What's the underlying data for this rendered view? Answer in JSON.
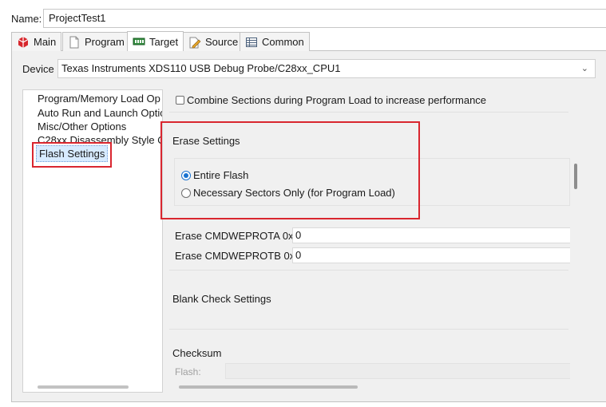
{
  "name": {
    "label": "Name:",
    "value": "ProjectTest1"
  },
  "tabs": [
    {
      "label": "Main",
      "icon": "main-tab-icon"
    },
    {
      "label": "Program",
      "icon": "program-tab-icon"
    },
    {
      "label": "Target",
      "icon": "target-tab-icon",
      "active": true
    },
    {
      "label": "Source",
      "icon": "source-tab-icon"
    },
    {
      "label": "Common",
      "icon": "common-tab-icon"
    }
  ],
  "device": {
    "label": "Device",
    "value": "Texas Instruments XDS110 USB Debug Probe/C28xx_CPU1"
  },
  "tree": {
    "items": [
      "Program/Memory Load Op",
      "Auto Run and Launch Optio",
      "Misc/Other Options",
      "C28xx Disassembly Style O",
      "Flash Settings"
    ],
    "selected": "Flash Settings"
  },
  "content": {
    "combine_checkbox": "Combine Sections during Program Load to increase performance",
    "erase": {
      "title": "Erase Settings",
      "options": [
        "Entire Flash",
        "Necessary Sectors Only (for Program Load)"
      ],
      "selected": "Entire Flash"
    },
    "cmdweprota": {
      "label": "Erase CMDWEPROTA 0x",
      "value": "0"
    },
    "cmdweprotb": {
      "label": "Erase CMDWEPROTB 0x",
      "value": "0"
    },
    "blank_check_title": "Blank Check Settings",
    "checksum_title": "Checksum",
    "flash_label": "Flash:"
  },
  "colors": {
    "highlight": "#d9262f",
    "radio_accent": "#1a73d0",
    "selection_bg": "#d7ebff"
  }
}
